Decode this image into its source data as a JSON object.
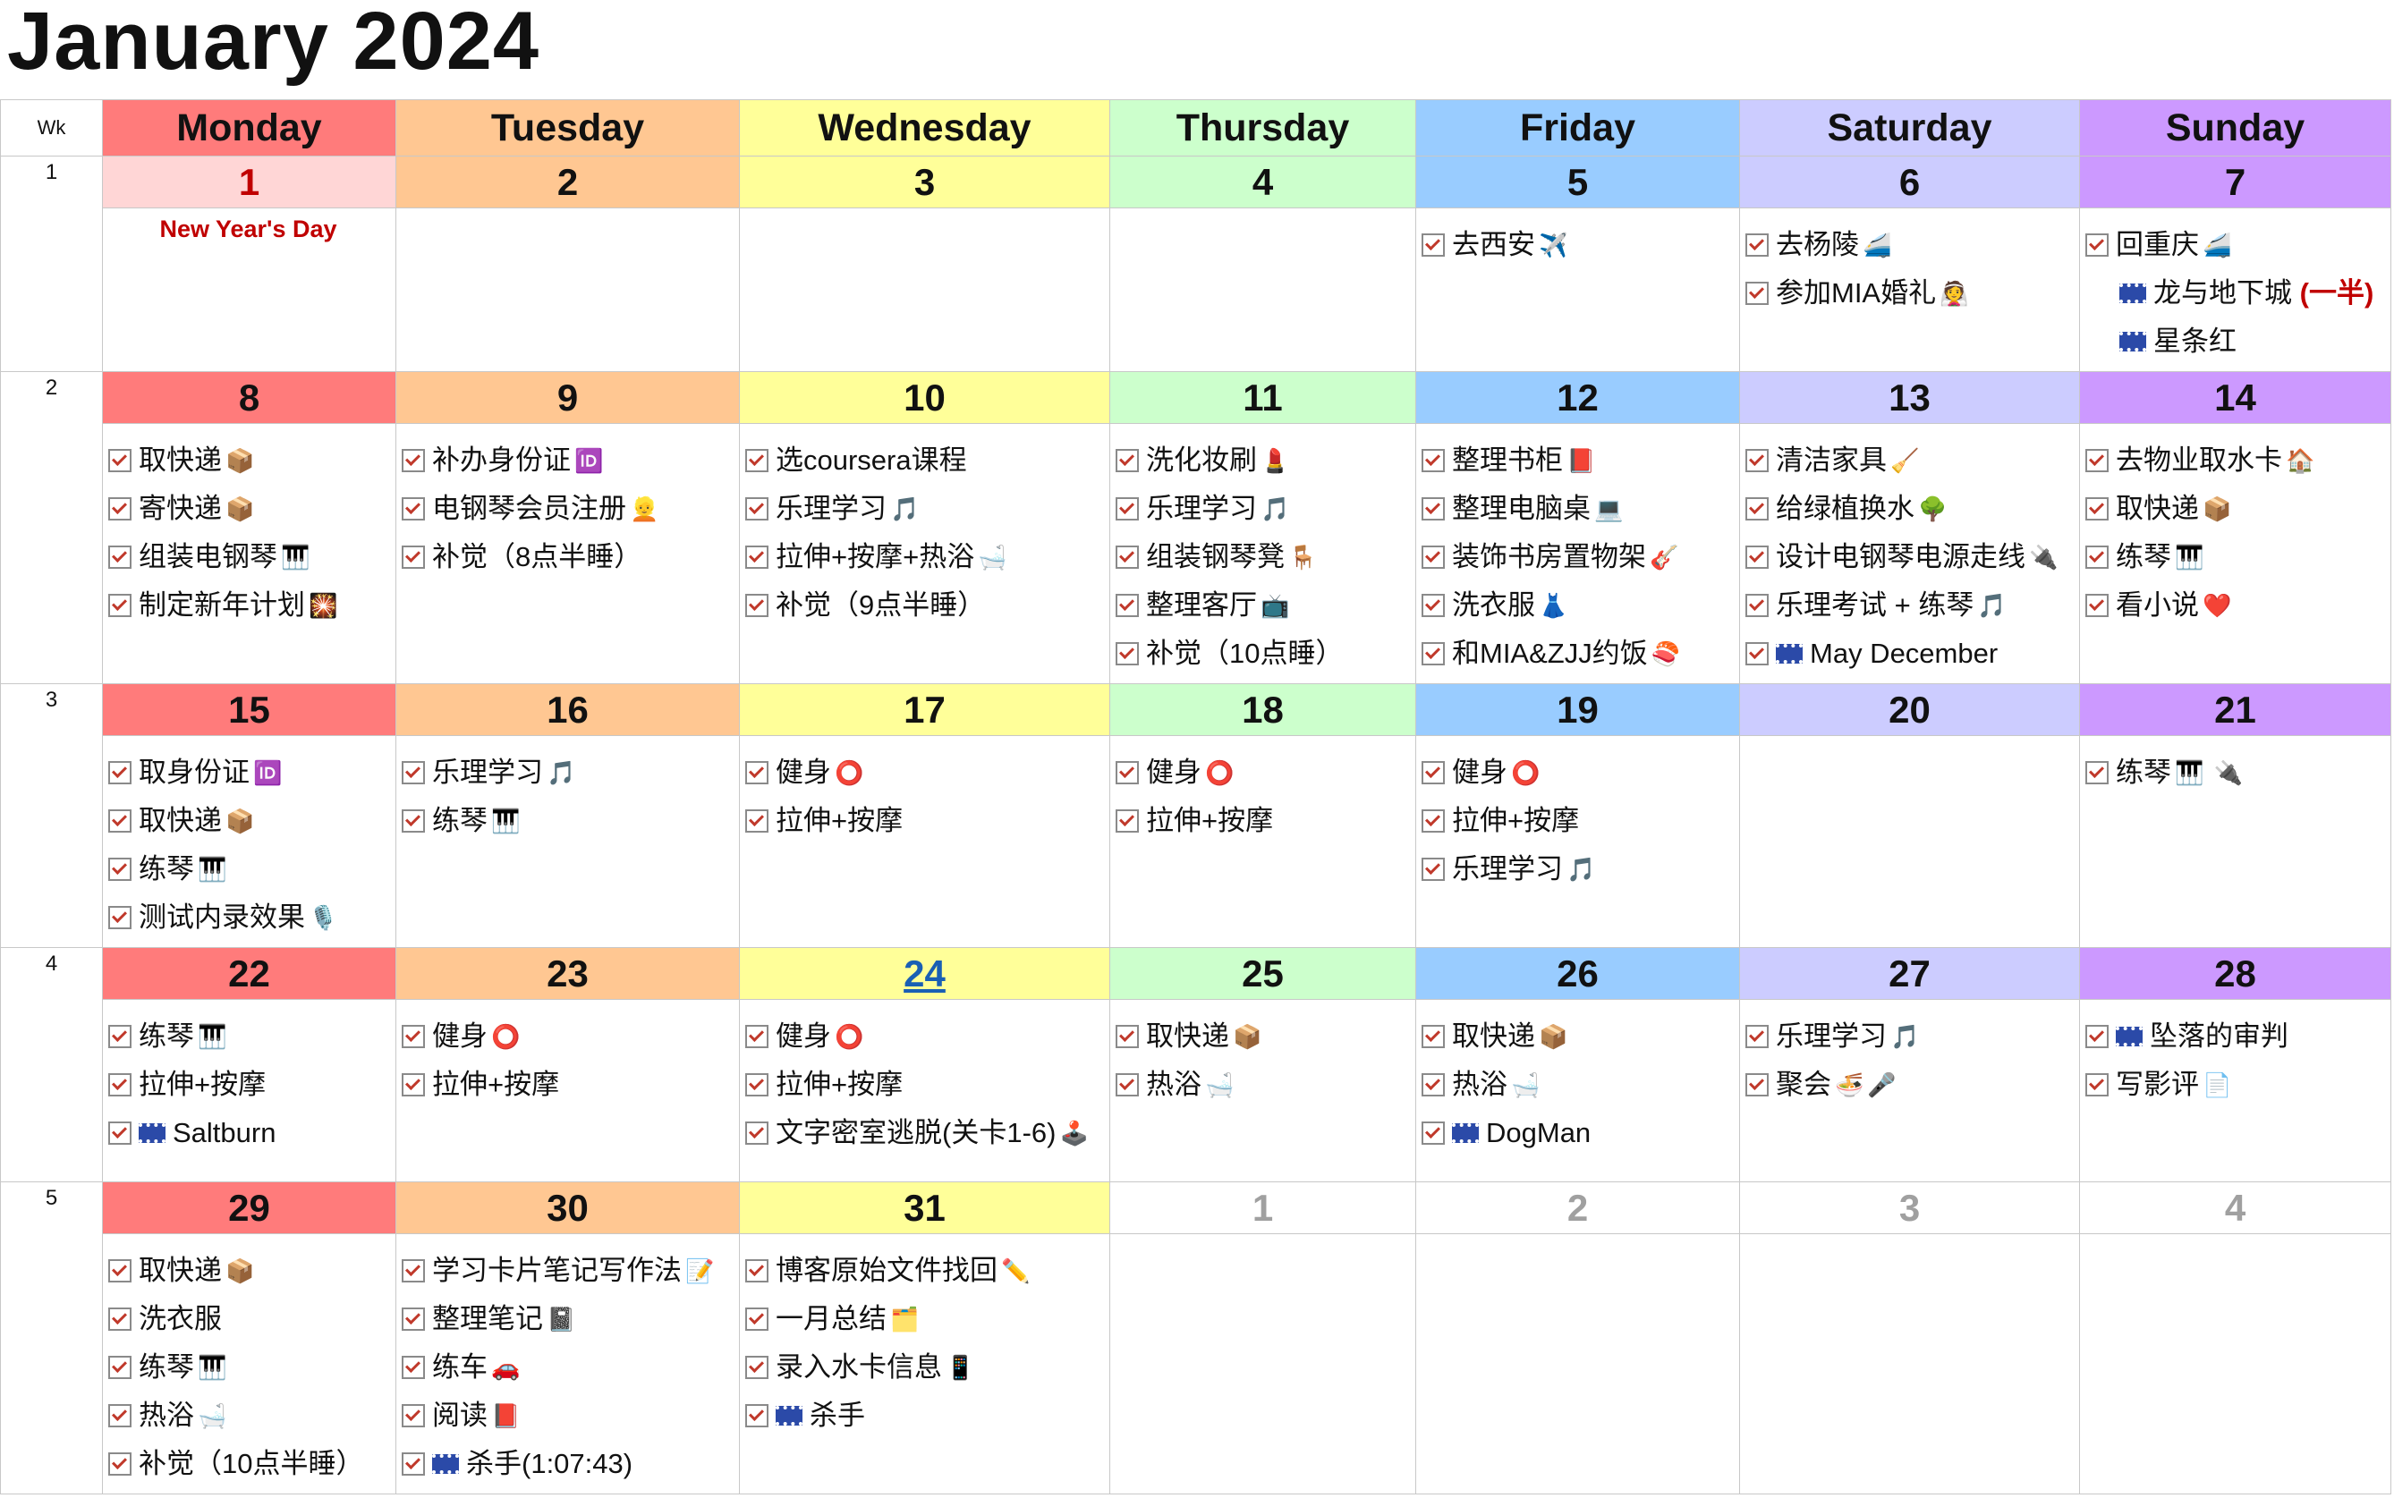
{
  "title": "January 2024",
  "week_label": "Wk",
  "days": [
    "Monday",
    "Tuesday",
    "Wednesday",
    "Thursday",
    "Friday",
    "Saturday",
    "Sunday"
  ],
  "colors": {
    "monday": "#ff7b7b",
    "tuesday": "#ffc792",
    "wednesday": "#ffff99",
    "thursday": "#ccffcc",
    "friday": "#99ccff",
    "saturday": "#ccccff",
    "sunday": "#cc99ff",
    "monday_date_wk1": "#ffd6d6"
  },
  "weeks": [
    {
      "wk": "1",
      "dates": [
        "1",
        "2",
        "3",
        "4",
        "5",
        "6",
        "7"
      ]
    },
    {
      "wk": "2",
      "dates": [
        "8",
        "9",
        "10",
        "11",
        "12",
        "13",
        "14"
      ]
    },
    {
      "wk": "3",
      "dates": [
        "15",
        "16",
        "17",
        "18",
        "19",
        "20",
        "21"
      ]
    },
    {
      "wk": "4",
      "dates": [
        "22",
        "23",
        "24",
        "25",
        "26",
        "27",
        "28"
      ]
    },
    {
      "wk": "5",
      "dates": [
        "29",
        "30",
        "31",
        "1",
        "2",
        "3",
        "4"
      ]
    }
  ],
  "holiday": "New Year's Day",
  "events": {
    "w1": {
      "fri": [
        "去西安"
      ],
      "sat": [
        "去杨陵",
        "参加MIA婚礼"
      ],
      "sun": [
        "回重庆",
        "龙与地下城",
        "(一半)",
        "星条红"
      ]
    },
    "w2": {
      "mon": [
        "取快递",
        "寄快递",
        "组装电钢琴",
        "制定新年计划"
      ],
      "tue": [
        "补办身份证",
        "电钢琴会员注册",
        "补觉（8点半睡）"
      ],
      "wed": [
        "选coursera课程",
        "乐理学习",
        "拉伸+按摩+热浴",
        "补觉（9点半睡）"
      ],
      "thu": [
        "洗化妆刷",
        "乐理学习",
        "组装钢琴凳",
        "整理客厅",
        "补觉（10点睡）"
      ],
      "fri": [
        "整理书柜",
        "整理电脑桌",
        "装饰书房置物架",
        "洗衣服",
        "和MIA&ZJJ约饭"
      ],
      "sat": [
        "清洁家具",
        "给绿植换水",
        "设计电钢琴电源走线",
        "乐理考试 + 练琴",
        "May December"
      ],
      "sun": [
        "去物业取水卡",
        "取快递",
        "练琴",
        "看小说"
      ]
    },
    "w3": {
      "mon": [
        "取身份证",
        "取快递",
        "练琴",
        "测试内录效果"
      ],
      "tue": [
        "乐理学习",
        "练琴"
      ],
      "wed": [
        "健身",
        "拉伸+按摩"
      ],
      "thu": [
        "健身",
        "拉伸+按摩"
      ],
      "fri": [
        "健身",
        "拉伸+按摩",
        "乐理学习"
      ],
      "sun": [
        "练琴"
      ]
    },
    "w4": {
      "mon": [
        "练琴",
        "拉伸+按摩",
        "Saltburn"
      ],
      "tue": [
        "健身",
        "拉伸+按摩"
      ],
      "wed": [
        "健身",
        "拉伸+按摩",
        "文字密室逃脱(关卡1-6)"
      ],
      "thu": [
        "取快递",
        "热浴"
      ],
      "fri": [
        "取快递",
        "热浴",
        "DogMan"
      ],
      "sat": [
        "乐理学习",
        "聚会"
      ],
      "sun": [
        "坠落的审判",
        "写影评"
      ]
    },
    "w5": {
      "mon": [
        "取快递",
        "洗衣服",
        "练琴",
        "热浴",
        "补觉（10点半睡）"
      ],
      "tue": [
        "学习卡片笔记写作法",
        "整理笔记",
        "练车",
        "阅读",
        "杀手(1:07:43)"
      ],
      "wed": [
        "博客原始文件找回",
        "一月总结",
        "录入水卡信息",
        "杀手"
      ]
    }
  }
}
